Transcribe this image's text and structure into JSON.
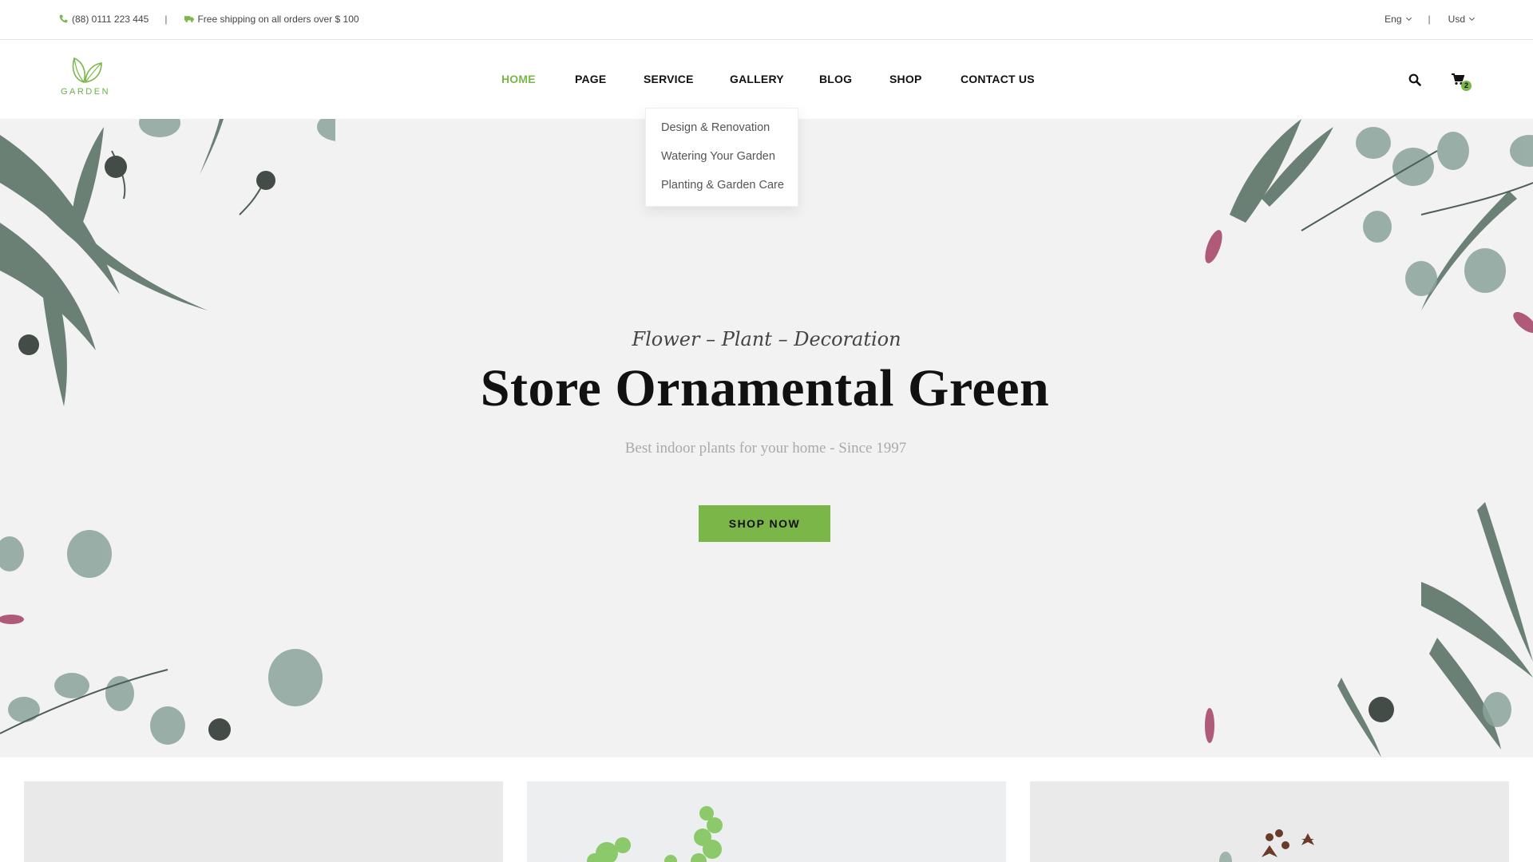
{
  "topbar": {
    "phone": "(88) 0111 223 445",
    "shipping": "Free shipping on all orders over $ 100",
    "separator": "|",
    "language": "Eng",
    "currency": "Usd"
  },
  "logo": {
    "text": "GARDEN"
  },
  "nav": {
    "items": [
      {
        "label": "HOME",
        "active": true
      },
      {
        "label": "PAGE"
      },
      {
        "label": "SERVICE"
      },
      {
        "label": "GALLERY"
      },
      {
        "label": "BLOG"
      },
      {
        "label": "SHOP"
      },
      {
        "label": "CONTACT US"
      }
    ]
  },
  "header_icons": {
    "search": "search-icon",
    "cart": "cart-icon",
    "cart_count": "2"
  },
  "service_dropdown": {
    "items": [
      "Design & Renovation",
      "Watering Your Garden",
      "Planting & Garden Care"
    ]
  },
  "hero": {
    "tagline": "Flower  –  Plant  –  Decoration",
    "title": "Store Ornamental Green",
    "subtitle": "Best indoor plants for your home - Since 1997",
    "button": "SHOP NOW"
  },
  "colors": {
    "accent": "#7ab648",
    "hero_bg": "#f2f2f2",
    "text_dark": "#111111"
  }
}
